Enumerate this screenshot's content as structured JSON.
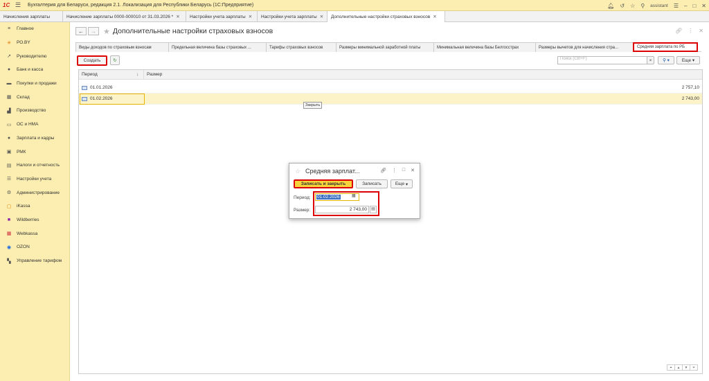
{
  "titlebar": {
    "title": "Бухгалтерия для Беларуси, редакция 2.1. Локализация для Республики Беларусь   (1С:Предприятие)",
    "user": "assistant"
  },
  "open_tabs": [
    {
      "label": "Начисления зарплаты"
    },
    {
      "label": "Начисление зарплаты 0000-000010 от 31.03.2026 *"
    },
    {
      "label": "Настройки учета зарплаты"
    },
    {
      "label": "Настройки учета зарплаты"
    },
    {
      "label": "Дополнительные настройки страховых взносов"
    }
  ],
  "sidebar": {
    "items": [
      {
        "label": "Главное",
        "icon": "menu-icon"
      },
      {
        "label": "РО.BY",
        "icon": "sun-icon"
      },
      {
        "label": "Руководителю",
        "icon": "chart-icon"
      },
      {
        "label": "Банк и касса",
        "icon": "bank-icon"
      },
      {
        "label": "Покупки и продажи",
        "icon": "cart-icon"
      },
      {
        "label": "Склад",
        "icon": "warehouse-icon"
      },
      {
        "label": "Производство",
        "icon": "factory-icon"
      },
      {
        "label": "ОС и НМА",
        "icon": "car-icon"
      },
      {
        "label": "Зарплата и кадры",
        "icon": "person-icon"
      },
      {
        "label": "РМК",
        "icon": "register-icon"
      },
      {
        "label": "Налоги и отчетность",
        "icon": "tax-icon"
      },
      {
        "label": "Настройки учета",
        "icon": "settings-list-icon"
      },
      {
        "label": "Администрирование",
        "icon": "gear-icon"
      },
      {
        "label": "iKassa",
        "icon": "ikassa-icon"
      },
      {
        "label": "Wildberries",
        "icon": "wildberries-icon"
      },
      {
        "label": "Webkassa",
        "icon": "webkassa-icon"
      },
      {
        "label": "OZON",
        "icon": "ozon-icon"
      },
      {
        "label": "Управление тарифом",
        "icon": "tariff-icon"
      }
    ]
  },
  "page": {
    "title": "Дополнительные настройки страховых взносов"
  },
  "subtabs": [
    {
      "label": "Виды доходов по страховым взносам"
    },
    {
      "label": "Предельная величина базы страховых ..."
    },
    {
      "label": "Тарифы страховых взносов"
    },
    {
      "label": "Размеры минимальной заработной платы"
    },
    {
      "label": "Минимальная величина базы Белгосстрах"
    },
    {
      "label": "Размеры вычетов для начисления стра..."
    },
    {
      "label": "Средняя зарплата по РБ"
    }
  ],
  "toolbar": {
    "create_label": "Создать",
    "search_placeholder": "Поиск (Ctrl+F)",
    "more_label": "Еще"
  },
  "grid": {
    "columns": {
      "period": "Период",
      "size": "Размер"
    },
    "rows": [
      {
        "date": "01.01.2026",
        "value": "2 757,10"
      },
      {
        "date": "01.02.2026",
        "value": "2 743,00"
      }
    ],
    "tooltip": "Закрыть"
  },
  "dialog": {
    "title": "Средняя зарплат...",
    "save_close_label": "Записать и закрыть",
    "save_label": "Записать",
    "more_label": "Еще",
    "period_label": "Период:",
    "period_value": "01.02.2026",
    "size_label": "Размер:",
    "size_value": "2 743,00"
  }
}
